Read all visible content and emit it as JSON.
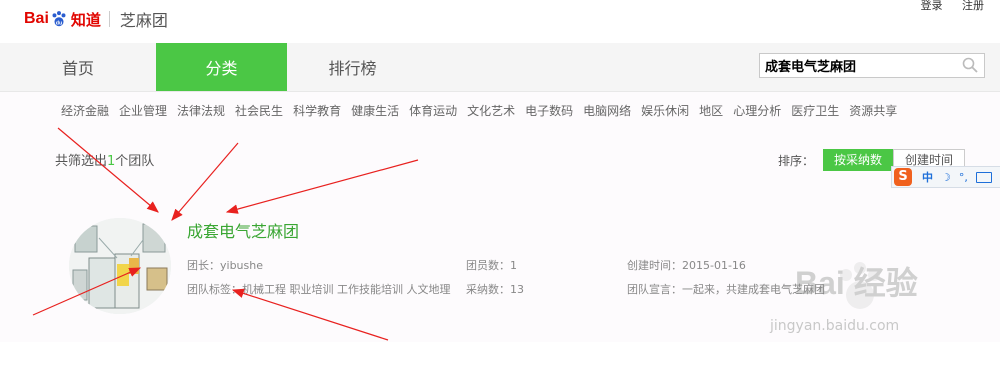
{
  "header": {
    "logo_bai": "Bai",
    "logo_zhidao": "知道",
    "site_name": "芝麻团",
    "links": [
      "登录",
      "注册"
    ]
  },
  "nav": {
    "tabs": [
      {
        "label": "首页",
        "active": false
      },
      {
        "label": "分类",
        "active": true
      },
      {
        "label": "排行榜",
        "active": false
      }
    ],
    "search_value": "成套电气芝麻团"
  },
  "categories": [
    "经济金融",
    "企业管理",
    "法律法规",
    "社会民生",
    "科学教育",
    "健康生活",
    "体育运动",
    "文化艺术",
    "电子数码",
    "电脑网络",
    "娱乐休闲",
    "地区",
    "心理分析",
    "医疗卫生",
    "资源共享"
  ],
  "result": {
    "prefix": "共筛选出",
    "count": "1",
    "suffix": "个团队"
  },
  "sort": {
    "label": "排序：",
    "options": [
      {
        "label": "按采纳数",
        "active": true
      },
      {
        "label": "创建时间",
        "active": false
      }
    ]
  },
  "ime": {
    "logo": "S",
    "mode": "中",
    "moon": "☽",
    "punct": "°,"
  },
  "team": {
    "name": "成套电气芝麻团",
    "leader": "团长：yibushe",
    "members": "团员数：1",
    "created": "创建时间：2015-01-16",
    "tags": "团队标签：机械工程 职业培训 工作技能培训 人文地理",
    "adopted": "采纳数：13",
    "motto": "团队宣言：一起来，共建成套电气芝麻团"
  },
  "watermark": {
    "brand": "Bai 经验",
    "url": "jingyan.baidu.com"
  },
  "colors": {
    "accent": "#4bc745",
    "brand_red": "#e10601",
    "arrow": "#e8211f"
  }
}
